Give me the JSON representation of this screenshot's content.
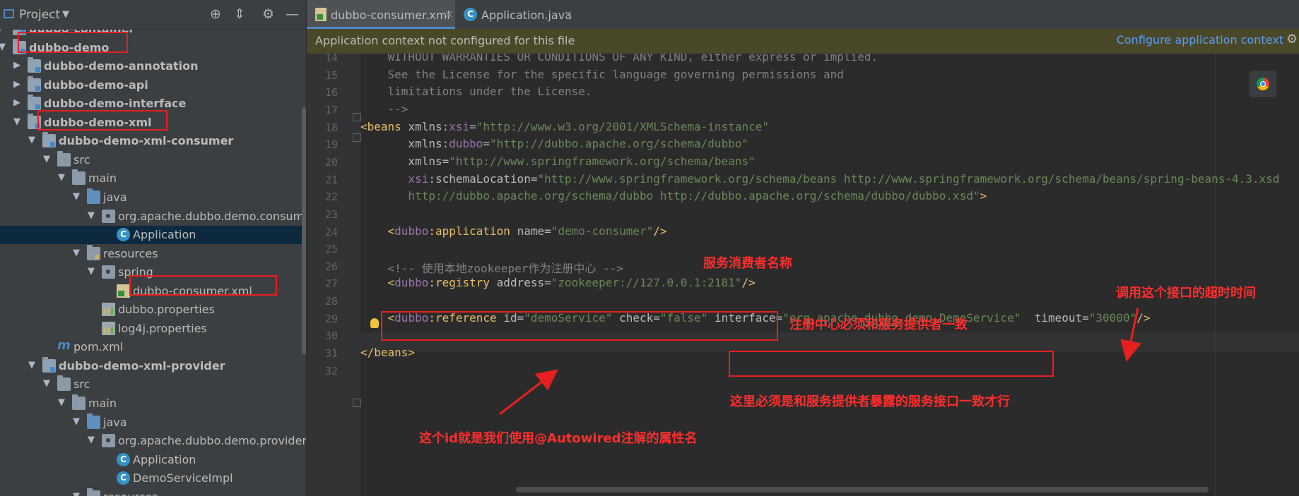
{
  "sidebar": {
    "title": "Project",
    "tree": [
      {
        "label": "dubbo-container",
        "bold": true,
        "icon": "module-folder-icon",
        "arrow": "collapsed"
      },
      {
        "label": "dubbo-demo",
        "bold": true,
        "icon": "module-folder-icon",
        "arrow": "expanded"
      },
      {
        "label": "dubbo-demo-annotation",
        "bold": true,
        "icon": "module-folder-icon",
        "arrow": "collapsed"
      },
      {
        "label": "dubbo-demo-api",
        "bold": true,
        "icon": "module-folder-icon",
        "arrow": "collapsed"
      },
      {
        "label": "dubbo-demo-interface",
        "bold": true,
        "icon": "module-folder-icon",
        "arrow": "collapsed"
      },
      {
        "label": "dubbo-demo-xml",
        "bold": true,
        "icon": "module-folder-icon",
        "arrow": "expanded"
      },
      {
        "label": "dubbo-demo-xml-consumer",
        "bold": true,
        "icon": "module-folder-icon",
        "arrow": "expanded"
      },
      {
        "label": "src",
        "bold": false,
        "icon": "folder-icon",
        "arrow": "expanded"
      },
      {
        "label": "main",
        "bold": false,
        "icon": "folder-icon",
        "arrow": "expanded"
      },
      {
        "label": "java",
        "bold": false,
        "icon": "source-folder-icon",
        "arrow": "expanded"
      },
      {
        "label": "org.apache.dubbo.demo.consumer",
        "bold": false,
        "icon": "package-icon",
        "arrow": "expanded"
      },
      {
        "label": "Application",
        "bold": false,
        "icon": "class-icon",
        "arrow": "none",
        "selected": true
      },
      {
        "label": "resources",
        "bold": false,
        "icon": "resources-folder-icon",
        "arrow": "expanded"
      },
      {
        "label": "spring",
        "bold": false,
        "icon": "package-icon",
        "arrow": "expanded"
      },
      {
        "label": "dubbo-consumer.xml",
        "bold": false,
        "icon": "spring-xml-icon",
        "arrow": "none"
      },
      {
        "label": "dubbo.properties",
        "bold": false,
        "icon": "properties-file-icon",
        "arrow": "none"
      },
      {
        "label": "log4j.properties",
        "bold": false,
        "icon": "properties-file-icon",
        "arrow": "none"
      },
      {
        "label": "pom.xml",
        "bold": false,
        "icon": "maven-icon",
        "arrow": "none"
      },
      {
        "label": "dubbo-demo-xml-provider",
        "bold": true,
        "icon": "module-folder-icon",
        "arrow": "expanded"
      },
      {
        "label": "src",
        "bold": false,
        "icon": "folder-icon",
        "arrow": "expanded"
      },
      {
        "label": "main",
        "bold": false,
        "icon": "folder-icon",
        "arrow": "expanded"
      },
      {
        "label": "java",
        "bold": false,
        "icon": "source-folder-icon",
        "arrow": "expanded"
      },
      {
        "label": "org.apache.dubbo.demo.provider",
        "bold": false,
        "icon": "package-icon",
        "arrow": "expanded"
      },
      {
        "label": "Application",
        "bold": false,
        "icon": "class-icon",
        "arrow": "none"
      },
      {
        "label": "DemoServiceImpl",
        "bold": false,
        "icon": "class-icon",
        "arrow": "none"
      },
      {
        "label": "resources",
        "bold": false,
        "icon": "resources-folder-icon",
        "arrow": "expanded"
      }
    ]
  },
  "tabs": [
    {
      "label": "dubbo-consumer.xml",
      "active": true,
      "close": "×"
    },
    {
      "label": "Application.java",
      "active": false,
      "close": "×"
    }
  ],
  "banner": {
    "message": "Application context not configured for this file",
    "link": "Configure application context"
  },
  "editor": {
    "current_line": 28,
    "lines": [
      {
        "n": "14",
        "tokens": [
          {
            "c": "cm",
            "t": "    WITHOUT WARRANTIES OR CONDITIONS OF ANY KIND, either express or implied."
          }
        ]
      },
      {
        "n": "15",
        "tokens": [
          {
            "c": "cm",
            "t": "    See the License for the specific language governing permissions and"
          }
        ]
      },
      {
        "n": "16",
        "tokens": [
          {
            "c": "cm",
            "t": "    limitations under the License."
          }
        ]
      },
      {
        "n": "17",
        "tokens": [
          {
            "c": "cm",
            "t": "    -->"
          }
        ]
      },
      {
        "n": "18",
        "tokens": [
          {
            "c": "tg",
            "t": "<beans "
          },
          {
            "c": "at",
            "t": "xmlns:"
          },
          {
            "c": "ns",
            "t": "xsi"
          },
          {
            "c": "at",
            "t": "="
          },
          {
            "c": "vl",
            "t": "\"http://www.w3.org/2001/XMLSchema-instance\""
          }
        ]
      },
      {
        "n": "19",
        "tokens": [
          {
            "c": "at",
            "t": "       xmlns:"
          },
          {
            "c": "ns",
            "t": "dubbo"
          },
          {
            "c": "at",
            "t": "="
          },
          {
            "c": "vl",
            "t": "\"http://dubbo.apache.org/schema/dubbo\""
          }
        ]
      },
      {
        "n": "20",
        "tokens": [
          {
            "c": "at",
            "t": "       xmlns="
          },
          {
            "c": "vl",
            "t": "\"http://www.springframework.org/schema/beans\""
          }
        ]
      },
      {
        "n": "21",
        "tokens": [
          {
            "c": "ns",
            "t": "       xsi"
          },
          {
            "c": "at",
            "t": ":schemaLocation="
          },
          {
            "c": "vl",
            "t": "\"http://www.springframework.org/schema/beans http://www.springframework.org/schema/beans/spring-beans-4.3.xsd"
          }
        ]
      },
      {
        "n": "22",
        "tokens": [
          {
            "c": "vl",
            "t": "       http://dubbo.apache.org/schema/dubbo http://dubbo.apache.org/schema/dubbo/dubbo.xsd\""
          },
          {
            "c": "tg",
            "t": ">"
          }
        ]
      },
      {
        "n": "23",
        "tokens": []
      },
      {
        "n": "24",
        "tokens": [
          {
            "c": "tg",
            "t": "    <"
          },
          {
            "c": "ns",
            "t": "dubbo"
          },
          {
            "c": "tg",
            "t": ":application "
          },
          {
            "c": "at",
            "t": "name="
          },
          {
            "c": "vl",
            "t": "\"demo-consumer\""
          },
          {
            "c": "tg",
            "t": "/>"
          }
        ]
      },
      {
        "n": "25",
        "tokens": []
      },
      {
        "n": "26",
        "tokens": [
          {
            "c": "cm",
            "t": "    <!-- 使用本地zookeeper作为注册中心 -->"
          }
        ]
      },
      {
        "n": "27",
        "tokens": [
          {
            "c": "tg",
            "t": "    <"
          },
          {
            "c": "ns",
            "t": "dubbo"
          },
          {
            "c": "tg",
            "t": ":registry "
          },
          {
            "c": "at",
            "t": "address="
          },
          {
            "c": "vl",
            "t": "\"zookeeper://127.0.0.1:2181\""
          },
          {
            "c": "tg",
            "t": "/>"
          }
        ]
      },
      {
        "n": "28",
        "tokens": []
      },
      {
        "n": "29",
        "tokens": [
          {
            "c": "tg",
            "t": "    <"
          },
          {
            "c": "ns",
            "t": "dubbo"
          },
          {
            "c": "tg",
            "t": ":reference "
          },
          {
            "c": "at",
            "t": "id="
          },
          {
            "c": "vl",
            "t": "\"demoService\""
          },
          {
            "c": "at",
            "t": " check="
          },
          {
            "c": "vl",
            "t": "\"false\""
          },
          {
            "c": "at",
            "t": " interface="
          },
          {
            "c": "vl",
            "t": "\"org.apache."
          },
          {
            "c": "vl squig",
            "t": "dubbo"
          },
          {
            "c": "vl",
            "t": ".demo.DemoService\""
          },
          {
            "c": "at",
            "t": "  timeout="
          },
          {
            "c": "vl",
            "t": "\"30000\""
          },
          {
            "c": "tg",
            "t": "/>"
          }
        ]
      },
      {
        "n": "30",
        "tokens": []
      },
      {
        "n": "31",
        "tokens": [
          {
            "c": "tg",
            "t": "</beans>"
          }
        ]
      },
      {
        "n": "32",
        "tokens": []
      }
    ]
  },
  "annotations": {
    "consumer_name": "服务消费者名称",
    "timeout_note": "调用这个接口的超时时间",
    "registry_note": "注册中心必须和服务提供者一致",
    "interface_note": "这里必须是和服务提供者暴露的服务接口一致才行",
    "id_note": "这个id就是我们使用@Autowired注解的属性名"
  },
  "colors": {
    "annotation_red": "#e81f1f",
    "xml_tag": "#e8bf6a",
    "xml_value": "#6a8759",
    "namespace": "#9876aa"
  }
}
